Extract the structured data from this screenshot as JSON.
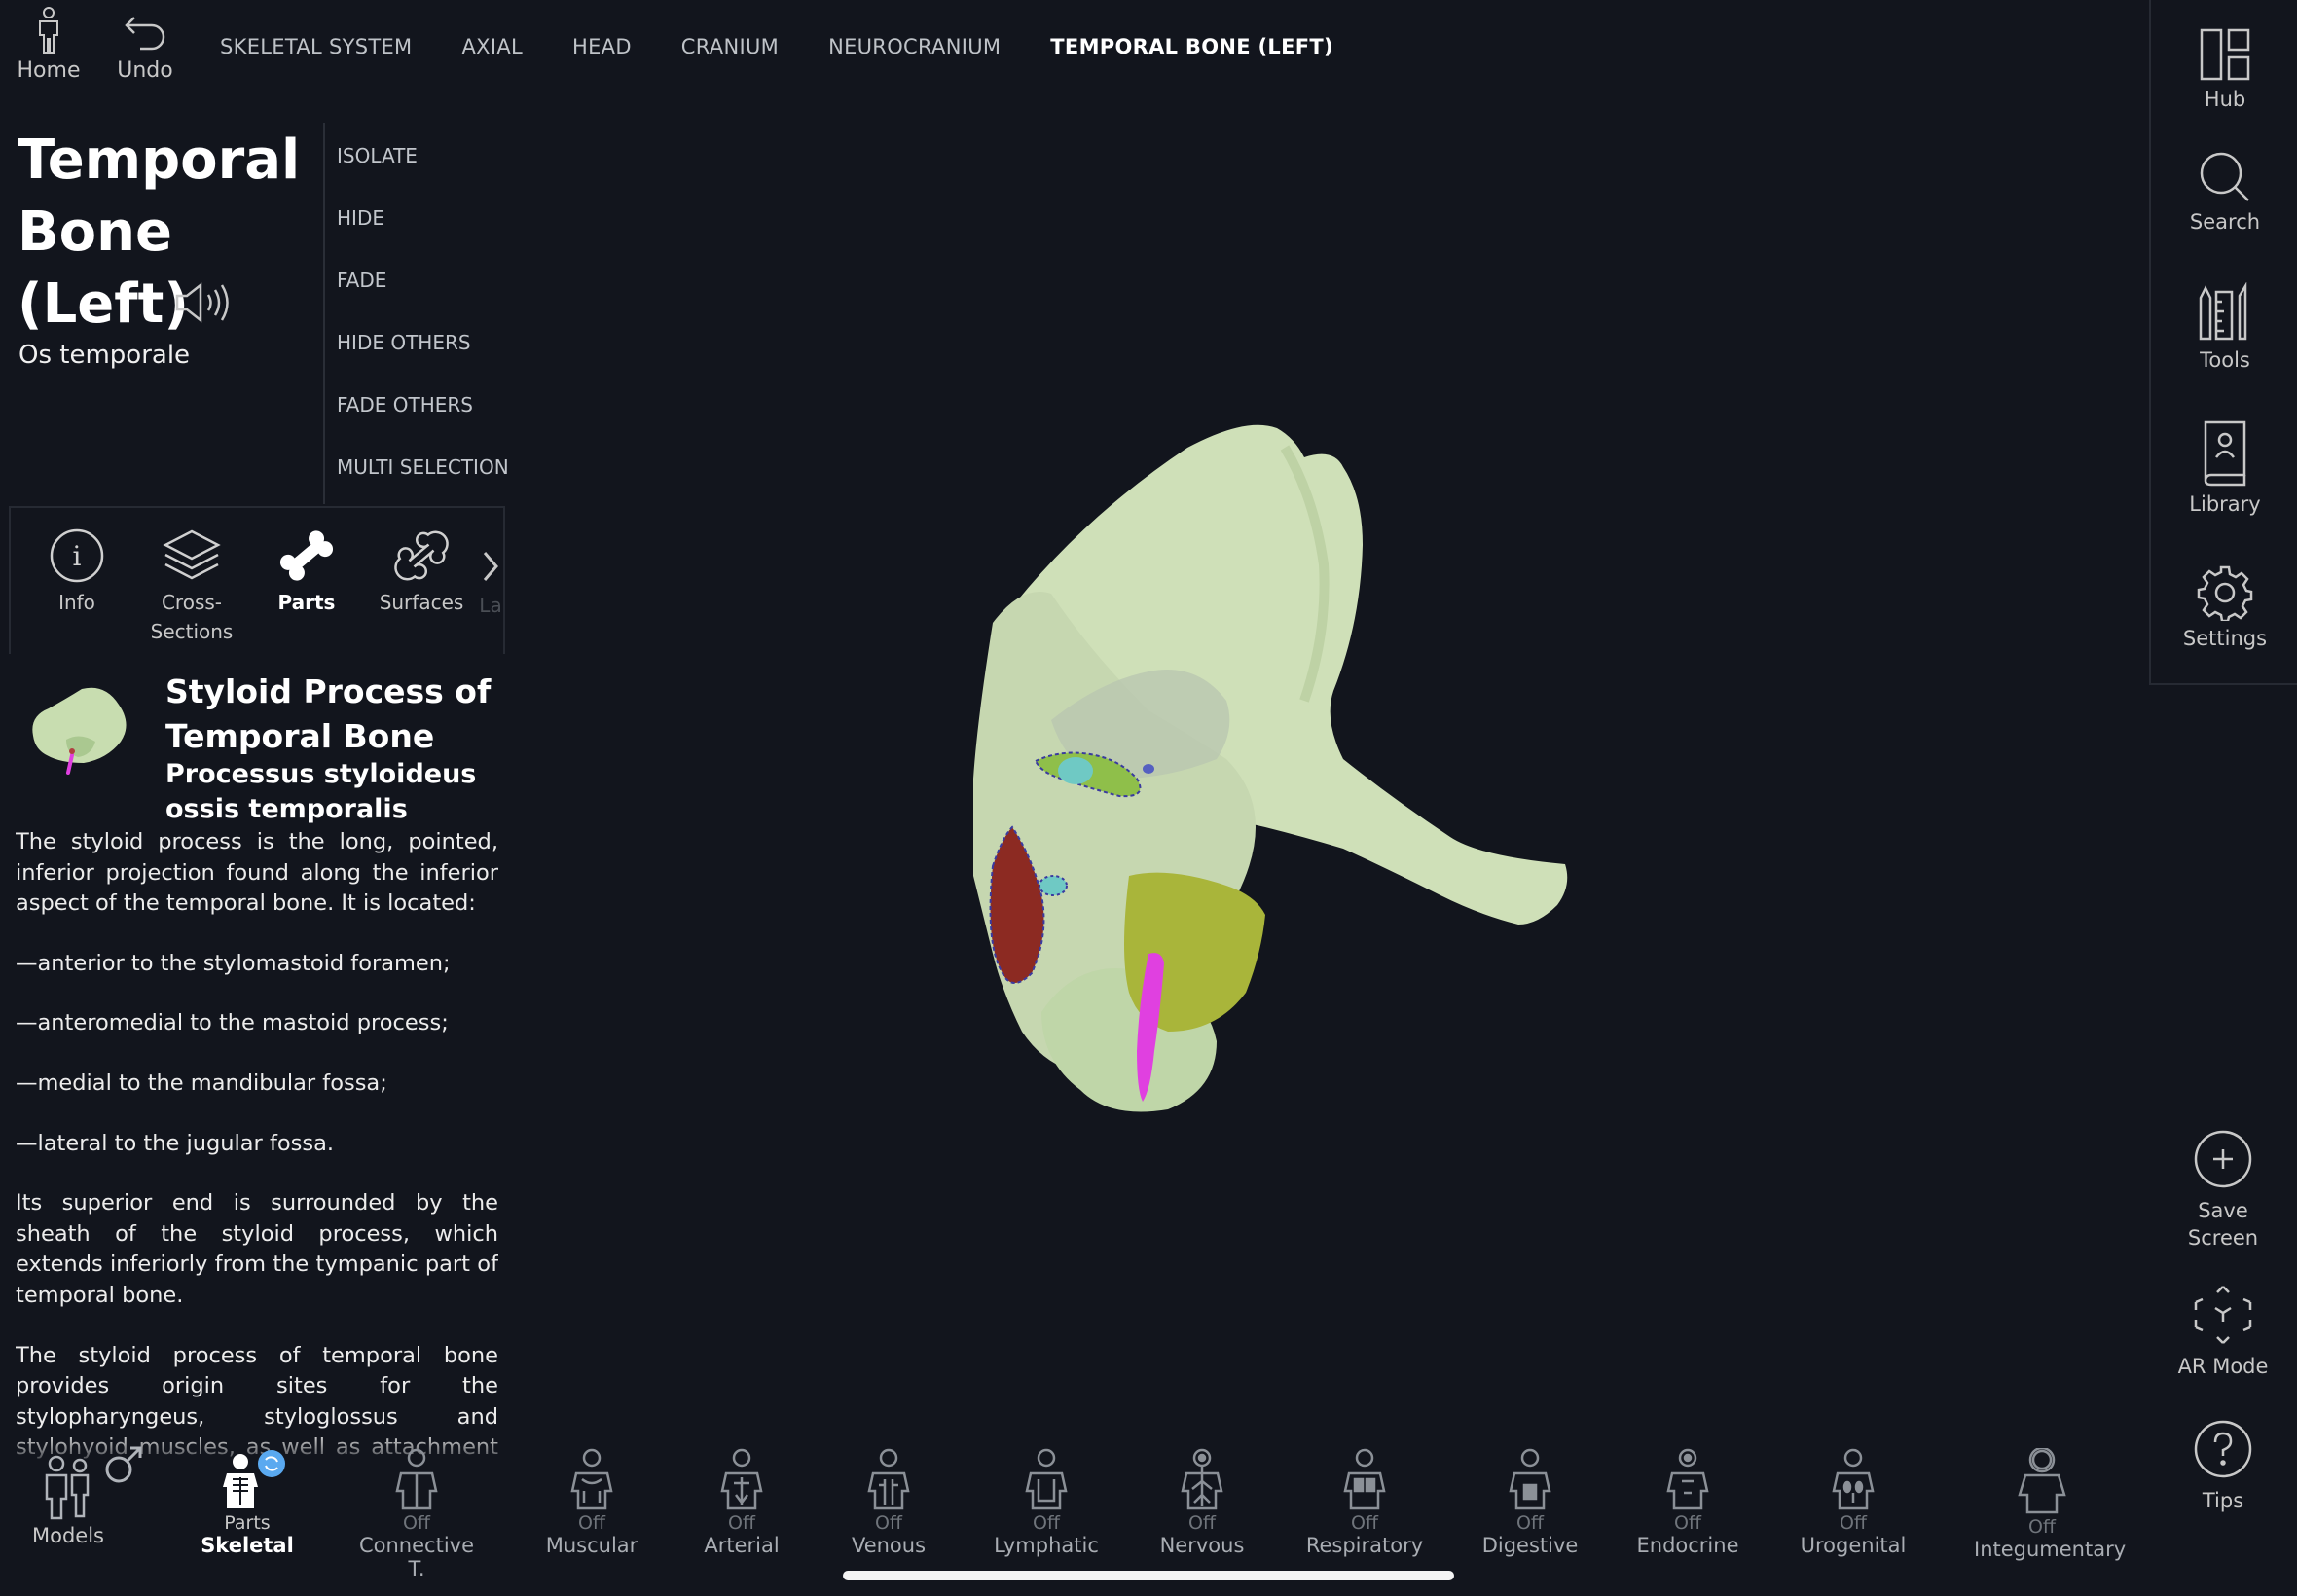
{
  "topbar": {
    "home_label": "Home",
    "undo_label": "Undo",
    "breadcrumbs": [
      "SKELETAL SYSTEM",
      "AXIAL",
      "HEAD",
      "CRANIUM",
      "NEUROCRANIUM",
      "TEMPORAL BONE (LEFT)"
    ]
  },
  "structure": {
    "title_line1": "Temporal",
    "title_line2": "Bone",
    "title_line3": "(Left)",
    "latin": "Os temporale"
  },
  "actions": [
    "ISOLATE",
    "HIDE",
    "FADE",
    "HIDE OTHERS",
    "FADE OTHERS",
    "MULTI SELECTION"
  ],
  "tabs": [
    {
      "label": "Info",
      "icon": "info-icon"
    },
    {
      "label": "Cross-\nSections",
      "icon": "layers-icon"
    },
    {
      "label": "Parts",
      "icon": "bone-icon"
    },
    {
      "label": "Surfaces",
      "icon": "bone-outline-icon"
    },
    {
      "label": "La",
      "icon": "chevron-right-icon"
    }
  ],
  "part": {
    "name": "Styloid Process of Temporal Bone",
    "latin": "Processus styloideus ossis temporalis",
    "description": [
      "The styloid process is the long, pointed, inferior projection found along the inferior aspect of the temporal bone. It is located:",
      "—anterior to the stylomastoid foramen;",
      "—anteromedial to the mastoid process;",
      "—medial to the mandibular fossa;",
      "—lateral to the jugular fossa.",
      "Its superior end is surrounded by the sheath of the styloid process, which extends inferiorly from the tympanic part of temporal bone.",
      "The styloid process of temporal bone provides origin sites for the stylopharyngeus, styloglossus and stylohyoid muscles, as well as attachment sites for the stylomandibular and stylohyoid ligaments."
    ]
  },
  "rightbar": {
    "hub": "Hub",
    "search": "Search",
    "tools": "Tools",
    "library": "Library",
    "settings": "Settings",
    "save_screen": "Save\nScreen",
    "ar_mode": "AR Mode",
    "tips": "Tips"
  },
  "systems": {
    "models": "Models",
    "items": [
      {
        "state": "Parts",
        "label": "Skeletal"
      },
      {
        "state": "Off",
        "label": "Connective T."
      },
      {
        "state": "Off",
        "label": "Muscular"
      },
      {
        "state": "Off",
        "label": "Arterial"
      },
      {
        "state": "Off",
        "label": "Venous"
      },
      {
        "state": "Off",
        "label": "Lymphatic"
      },
      {
        "state": "Off",
        "label": "Nervous"
      },
      {
        "state": "Off",
        "label": "Respiratory"
      },
      {
        "state": "Off",
        "label": "Digestive"
      },
      {
        "state": "Off",
        "label": "Endocrine"
      },
      {
        "state": "Off",
        "label": "Urogenital"
      },
      {
        "state": "Off",
        "label": "Integumentary"
      }
    ]
  },
  "colors": {
    "background": "#12151d",
    "bone": "#cfe0b8",
    "styloid_highlight": "#e040e0",
    "sync_badge": "#5aa9f0"
  }
}
